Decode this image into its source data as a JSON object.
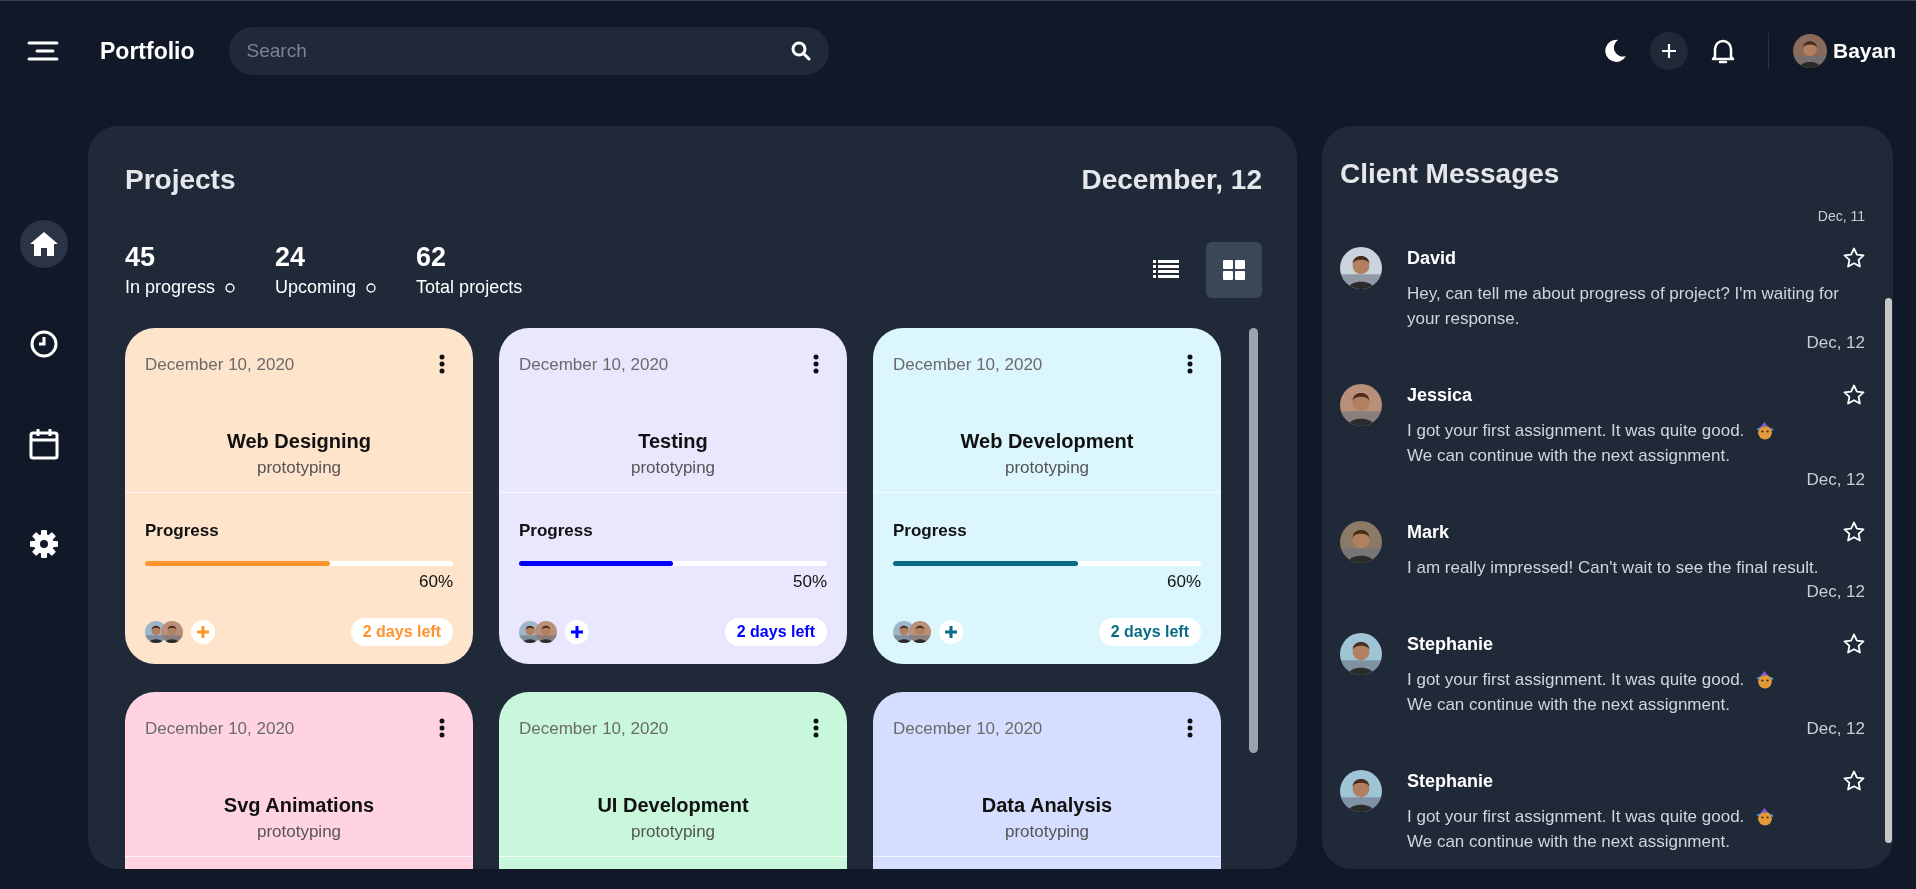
{
  "app": {
    "title": "Portfolio"
  },
  "search": {
    "placeholder": "Search"
  },
  "user": {
    "name": "Bayan"
  },
  "sidebar": {
    "items": [
      {
        "kind": "home",
        "selected": true
      },
      {
        "kind": "clock",
        "selected": false
      },
      {
        "kind": "calendar",
        "selected": false
      },
      {
        "kind": "settings",
        "selected": false
      }
    ]
  },
  "projects": {
    "title": "Projects",
    "date": "December, 12",
    "stats": [
      {
        "value": "45",
        "label": "In progress",
        "has_dot": true
      },
      {
        "value": "24",
        "label": "Upcoming",
        "has_dot": true
      },
      {
        "value": "62",
        "label": "Total projects",
        "has_dot": false
      }
    ],
    "view_options": [
      {
        "kind": "list",
        "selected": false
      },
      {
        "kind": "grid",
        "selected": true
      }
    ],
    "cards": [
      {
        "date": "December 10, 2020",
        "title": "Web Designing",
        "subtitle": "prototyping",
        "color": "#fee4cb",
        "progress": {
          "label": "Progress",
          "level": 0.6,
          "reading": "60%",
          "color": "#ff942e"
        },
        "days_left": "2 days left"
      },
      {
        "date": "December 10, 2020",
        "title": "Testing",
        "subtitle": "prototyping",
        "color": "#e9e7fd",
        "progress": {
          "label": "Progress",
          "level": 0.5,
          "reading": "50%",
          "color": "#0000ff"
        },
        "days_left": "2 days left"
      },
      {
        "date": "December 10, 2020",
        "title": "Web Development",
        "subtitle": "prototyping",
        "color": "#dbf6fd",
        "progress": {
          "label": "Progress",
          "level": 0.6,
          "reading": "60%",
          "color": "#096c86"
        },
        "days_left": "2 days left"
      },
      {
        "date": "December 10, 2020",
        "title": "Svg Animations",
        "subtitle": "prototyping",
        "color": "#ffd3e2"
      },
      {
        "date": "December 10, 2020",
        "title": "UI Development",
        "subtitle": "prototyping",
        "color": "#c8f7dc"
      },
      {
        "date": "December 10, 2020",
        "title": "Data Analysis",
        "subtitle": "prototyping",
        "color": "#d5deff"
      }
    ]
  },
  "messages": {
    "title": "Client Messages",
    "earlier_date": "Dec, 11",
    "items": [
      {
        "name": "David",
        "text": "Hey, can tell me about progress of project? I'm waiting for your response.",
        "emoji": false,
        "date": "Dec, 12",
        "starred": false
      },
      {
        "name": "Jessica",
        "text": "I got your first assignment. It was quite good.",
        "emoji": true,
        "text_after": "We can continue with the next assignment.",
        "date": "Dec, 12",
        "starred": false
      },
      {
        "name": "Mark",
        "text": "I am really impressed! Can't wait to see the final result.",
        "emoji": false,
        "date": "Dec, 12",
        "starred": false
      },
      {
        "name": "Stephanie",
        "text": "I got your first assignment. It was quite good.",
        "emoji": true,
        "text_after": "We can continue with the next assignment.",
        "date": "Dec, 12",
        "starred": false
      },
      {
        "name": "Stephanie",
        "text": "I got your first assignment. It was quite good.",
        "emoji": true,
        "text_after": "We can continue with the next assignment.",
        "starred": false
      }
    ]
  }
}
